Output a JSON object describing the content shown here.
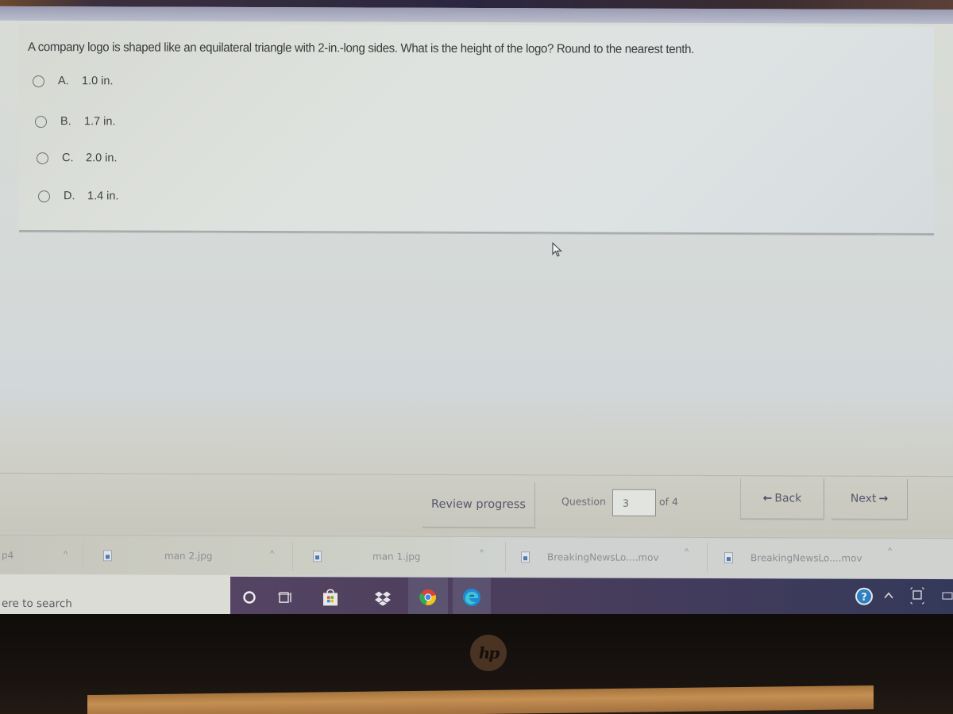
{
  "question": {
    "text": "A company logo is shaped like an equilateral triangle with 2-in.-long sides. What is the height of the logo? Round to the nearest tenth.",
    "choices": [
      {
        "letter": "A.",
        "value": "1.0 in.",
        "selected": false
      },
      {
        "letter": "B.",
        "value": "1.7 in.",
        "selected": false
      },
      {
        "letter": "C.",
        "value": "2.0 in.",
        "selected": false
      },
      {
        "letter": "D.",
        "value": "1.4 in.",
        "selected": false
      }
    ]
  },
  "navigation": {
    "review_progress_label": "Review progress",
    "question_label": "Question",
    "question_current": "3",
    "question_total_label": "of 4",
    "back_label": "Back",
    "back_arrow": "🡐",
    "next_label": "Next",
    "next_arrow": "🡒"
  },
  "downloads": [
    {
      "name": "p4",
      "icon": "file-icon"
    },
    {
      "name": "man 2.jpg",
      "icon": "image-file-icon"
    },
    {
      "name": "man 1.jpg",
      "icon": "image-file-icon"
    },
    {
      "name": "BreakingNewsLo....mov",
      "icon": "video-file-icon"
    },
    {
      "name": "BreakingNewsLo....mov",
      "icon": "video-file-icon"
    }
  ],
  "taskbar": {
    "search_placeholder": "ere to search",
    "apps": [
      "cortana",
      "task-view",
      "microsoft-store",
      "dropbox",
      "chrome",
      "edge"
    ],
    "tray": [
      "help",
      "show-hidden-icons",
      "network"
    ]
  },
  "device": {
    "brand": "hp"
  }
}
